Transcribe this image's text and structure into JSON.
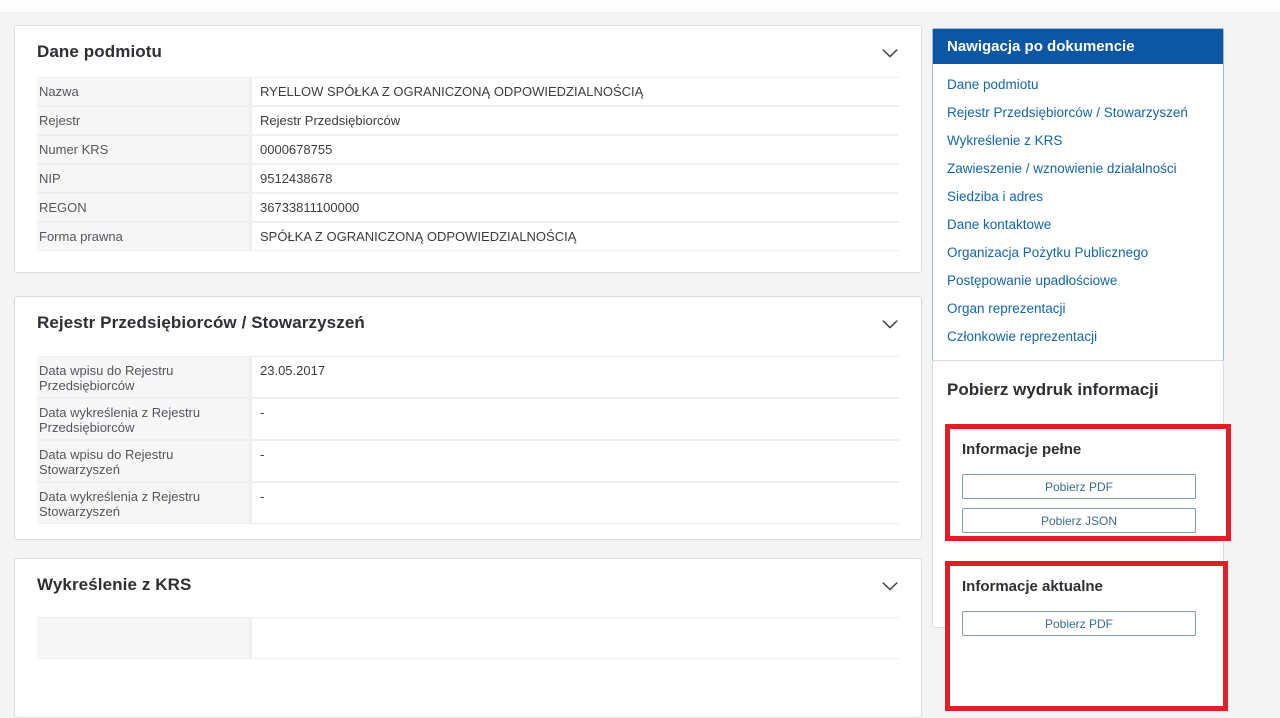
{
  "colors": {
    "nav_header_bg": "#0b57a4",
    "nav_link": "#1565a8",
    "highlight_red": "#de2026",
    "button_blue": "#3d6a90",
    "page_bg": "#f4f4f5"
  },
  "icons": {
    "panel_collapse": "chevron-down-icon"
  },
  "panels": [
    {
      "title": "Dane podmiotu",
      "rows": [
        {
          "label": "Nazwa",
          "value": "RYELLOW SPÓŁKA Z OGRANICZONĄ ODPOWIEDZIALNOŚCIĄ"
        },
        {
          "label": "Rejestr",
          "value": "Rejestr Przedsiębiorców"
        },
        {
          "label": "Numer KRS",
          "value": "0000678755"
        },
        {
          "label": "NIP",
          "value": "9512438678"
        },
        {
          "label": "REGON",
          "value": "36733811100000"
        },
        {
          "label": "Forma prawna",
          "value": "SPÓŁKA Z OGRANICZONĄ ODPOWIEDZIALNOŚCIĄ"
        }
      ]
    },
    {
      "title": "Rejestr Przedsiębiorców / Stowarzyszeń",
      "rows": [
        {
          "label": "Data wpisu do Rejestru Przedsiębiorców",
          "value": "23.05.2017"
        },
        {
          "label": "Data wykreślenia z Rejestru Przedsiębiorców",
          "value": "-"
        },
        {
          "label": "Data wpisu do Rejestru Stowarzyszeń",
          "value": "-"
        },
        {
          "label": "Data wykreślenia z Rejestru Stowarzyszeń",
          "value": "-"
        }
      ]
    },
    {
      "title": "Wykreślenie z KRS",
      "rows": []
    }
  ],
  "navigation": {
    "title": "Nawigacja po dokumencie",
    "items": [
      "Dane podmiotu",
      "Rejestr Przedsiębiorców / Stowarzyszeń",
      "Wykreślenie z KRS",
      "Zawieszenie / wznowienie działalności",
      "Siedziba i adres",
      "Dane kontaktowe",
      "Organizacja Pożytku Publicznego",
      "Postępowanie upadłościowe",
      "Organ reprezentacji",
      "Członkowie reprezentacji"
    ]
  },
  "downloads": {
    "title": "Pobierz wydruk informacji",
    "groups": [
      {
        "heading": "Informacje pełne",
        "buttons": [
          "Pobierz PDF",
          "Pobierz JSON"
        ]
      },
      {
        "heading": "Informacje aktualne",
        "buttons": [
          "Pobierz PDF"
        ]
      }
    ]
  }
}
